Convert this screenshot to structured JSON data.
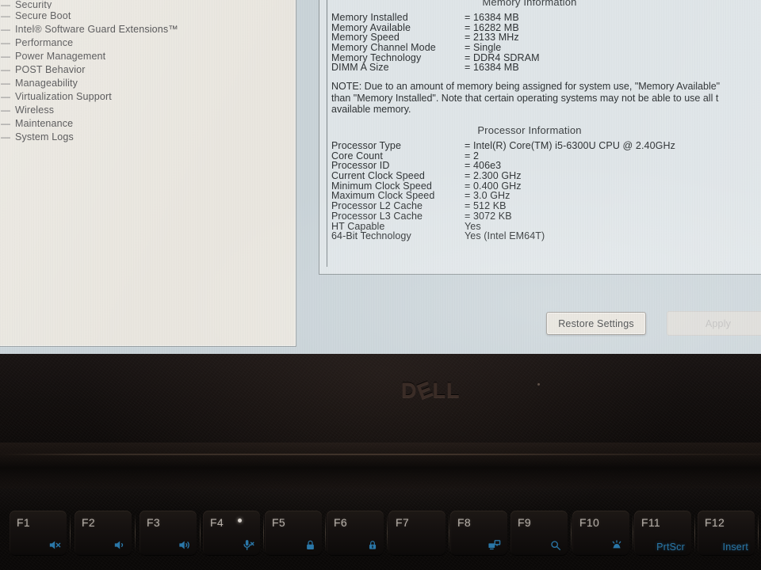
{
  "bios": {
    "sidebar": {
      "items": [
        {
          "label": "Security",
          "marker": "+",
          "clipped": true
        },
        {
          "label": "Secure Boot",
          "marker": "+",
          "clipped": false
        },
        {
          "label": "Intel® Software Guard Extensions™",
          "marker": "+",
          "clipped": false
        },
        {
          "label": "Performance",
          "marker": "+",
          "clipped": false
        },
        {
          "label": "Power Management",
          "marker": "+",
          "clipped": false
        },
        {
          "label": "POST Behavior",
          "marker": "+",
          "clipped": false
        },
        {
          "label": "Manageability",
          "marker": "+",
          "clipped": false
        },
        {
          "label": "Virtualization Support",
          "marker": "+",
          "clipped": false
        },
        {
          "label": "Wireless",
          "marker": "+",
          "clipped": false
        },
        {
          "label": "Maintenance",
          "marker": "+",
          "clipped": false
        },
        {
          "label": "System Logs",
          "marker": "+",
          "clipped": false
        }
      ]
    },
    "memory_section": {
      "title": "Memory Information",
      "rows": [
        {
          "key": "Memory Installed",
          "value": "= 16384 MB"
        },
        {
          "key": "Memory Available",
          "value": "= 16282 MB"
        },
        {
          "key": "Memory Speed",
          "value": "= 2133 MHz"
        },
        {
          "key": "Memory Channel Mode",
          "value": "= Single"
        },
        {
          "key": "Memory Technology",
          "value": "= DDR4 SDRAM"
        },
        {
          "key": "DIMM A Size",
          "value": "= 16384 MB"
        }
      ],
      "note_line1": "NOTE: Due to an amount of memory being assigned for system use, \"Memory Available\"",
      "note_line2": "than \"Memory Installed\". Note that certain operating systems may not be able to use all t",
      "note_line3": "available memory."
    },
    "processor_section": {
      "title": "Processor Information",
      "rows": [
        {
          "key": "Processor Type",
          "value": "= Intel(R) Core(TM) i5-6300U CPU @ 2.40GHz"
        },
        {
          "key": "Core Count",
          "value": "= 2"
        },
        {
          "key": "Processor ID",
          "value": "= 406e3"
        },
        {
          "key": "Current Clock Speed",
          "value": "= 2.300 GHz"
        },
        {
          "key": "Minimum Clock Speed",
          "value": "= 0.400 GHz"
        },
        {
          "key": "Maximum Clock Speed",
          "value": "= 3.0 GHz"
        },
        {
          "key": "Processor L2 Cache",
          "value": "= 512 KB"
        },
        {
          "key": "Processor L3 Cache",
          "value": "= 3072 KB"
        },
        {
          "key": "HT Capable",
          "value": "Yes"
        },
        {
          "key": "64-Bit Technology",
          "value": "Yes (Intel EM64T)"
        }
      ]
    },
    "buttons": {
      "restore_settings": "Restore Settings",
      "apply": "Apply"
    },
    "colors": {
      "screen_background": "#c9d3d8",
      "sidebar_background": "#e9e6df",
      "panel_background": "#dfe5e8",
      "tree_marker": "#c0395c",
      "text": "#2e3234"
    }
  },
  "chassis": {
    "brand": "DELL",
    "brand_letters": {
      "d": "D",
      "e": "E",
      "l1": "L",
      "l2": "L"
    },
    "colors": {
      "bezel": "#100d0c",
      "logo": "#3a2c26",
      "key_legend": "#b9b2ab",
      "key_function_icon": "#2a77a8"
    }
  },
  "keyboard": {
    "keys": [
      {
        "label": "F1",
        "icon": "speaker-mute-icon",
        "sub": "",
        "led": false
      },
      {
        "label": "F2",
        "icon": "volume-down-icon",
        "sub": "",
        "led": false
      },
      {
        "label": "F3",
        "icon": "volume-up-icon",
        "sub": "",
        "led": false
      },
      {
        "label": "F4",
        "icon": "microphone-mute-icon",
        "sub": "",
        "led": true
      },
      {
        "label": "F5",
        "icon": "num-lock-icon",
        "sub": "",
        "led": false
      },
      {
        "label": "F6",
        "icon": "scroll-lock-icon",
        "sub": "",
        "led": false
      },
      {
        "label": "F7",
        "icon": "",
        "sub": "",
        "led": false
      },
      {
        "label": "F8",
        "icon": "display-switch-icon",
        "sub": "",
        "led": false
      },
      {
        "label": "F9",
        "icon": "search-icon",
        "sub": "",
        "led": false
      },
      {
        "label": "F10",
        "icon": "keyboard-backlight-icon",
        "sub": "",
        "led": false
      },
      {
        "label": "F11",
        "icon": "",
        "sub": "PrtScr",
        "led": false
      },
      {
        "label": "F12",
        "icon": "",
        "sub": "Insert",
        "led": false
      }
    ]
  }
}
